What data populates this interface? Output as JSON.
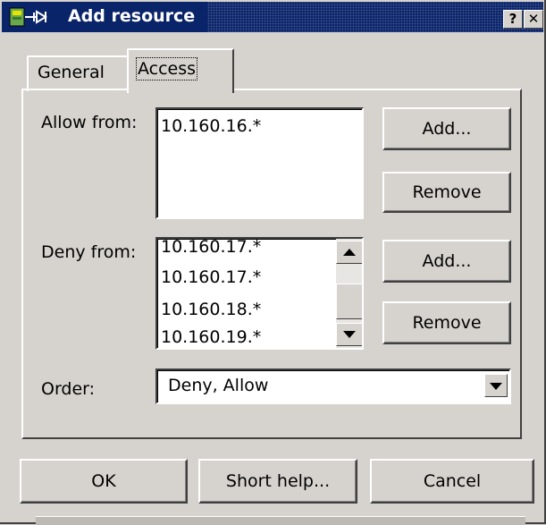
{
  "window": {
    "title": "Add resource",
    "help_label": "?",
    "close_label": "✕"
  },
  "tabs": [
    {
      "label": "General",
      "active": false
    },
    {
      "label": "Access",
      "active": true
    }
  ],
  "allow": {
    "label": "Allow from:",
    "items": [
      "10.160.16.*"
    ],
    "add_label": "Add...",
    "remove_label": "Remove"
  },
  "deny": {
    "label": "Deny from:",
    "items": [
      "10.160.17.*",
      "10.160.17.*",
      "10.160.18.*",
      "10.160.19.*"
    ],
    "add_label": "Add...",
    "remove_label": "Remove"
  },
  "order": {
    "label": "Order:",
    "value": "Deny, Allow"
  },
  "footer": {
    "ok_label": "OK",
    "help_label": "Short help...",
    "cancel_label": "Cancel"
  },
  "colors": {
    "titlebar": "#0a246a",
    "face": "#d6d3ce"
  }
}
